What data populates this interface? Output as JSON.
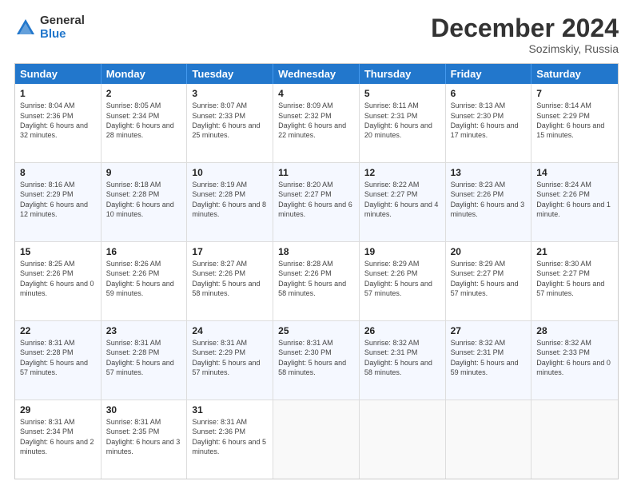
{
  "header": {
    "logo": {
      "general": "General",
      "blue": "Blue"
    },
    "title": "December 2024",
    "subtitle": "Sozimskiy, Russia"
  },
  "calendar": {
    "days_of_week": [
      "Sunday",
      "Monday",
      "Tuesday",
      "Wednesday",
      "Thursday",
      "Friday",
      "Saturday"
    ],
    "rows": [
      [
        {
          "day": "1",
          "sunrise": "8:04 AM",
          "sunset": "2:36 PM",
          "daylight": "6 hours and 32 minutes."
        },
        {
          "day": "2",
          "sunrise": "8:05 AM",
          "sunset": "2:34 PM",
          "daylight": "6 hours and 28 minutes."
        },
        {
          "day": "3",
          "sunrise": "8:07 AM",
          "sunset": "2:33 PM",
          "daylight": "6 hours and 25 minutes."
        },
        {
          "day": "4",
          "sunrise": "8:09 AM",
          "sunset": "2:32 PM",
          "daylight": "6 hours and 22 minutes."
        },
        {
          "day": "5",
          "sunrise": "8:11 AM",
          "sunset": "2:31 PM",
          "daylight": "6 hours and 20 minutes."
        },
        {
          "day": "6",
          "sunrise": "8:13 AM",
          "sunset": "2:30 PM",
          "daylight": "6 hours and 17 minutes."
        },
        {
          "day": "7",
          "sunrise": "8:14 AM",
          "sunset": "2:29 PM",
          "daylight": "6 hours and 15 minutes."
        }
      ],
      [
        {
          "day": "8",
          "sunrise": "8:16 AM",
          "sunset": "2:29 PM",
          "daylight": "6 hours and 12 minutes."
        },
        {
          "day": "9",
          "sunrise": "8:18 AM",
          "sunset": "2:28 PM",
          "daylight": "6 hours and 10 minutes."
        },
        {
          "day": "10",
          "sunrise": "8:19 AM",
          "sunset": "2:28 PM",
          "daylight": "6 hours and 8 minutes."
        },
        {
          "day": "11",
          "sunrise": "8:20 AM",
          "sunset": "2:27 PM",
          "daylight": "6 hours and 6 minutes."
        },
        {
          "day": "12",
          "sunrise": "8:22 AM",
          "sunset": "2:27 PM",
          "daylight": "6 hours and 4 minutes."
        },
        {
          "day": "13",
          "sunrise": "8:23 AM",
          "sunset": "2:26 PM",
          "daylight": "6 hours and 3 minutes."
        },
        {
          "day": "14",
          "sunrise": "8:24 AM",
          "sunset": "2:26 PM",
          "daylight": "6 hours and 1 minute."
        }
      ],
      [
        {
          "day": "15",
          "sunrise": "8:25 AM",
          "sunset": "2:26 PM",
          "daylight": "6 hours and 0 minutes."
        },
        {
          "day": "16",
          "sunrise": "8:26 AM",
          "sunset": "2:26 PM",
          "daylight": "5 hours and 59 minutes."
        },
        {
          "day": "17",
          "sunrise": "8:27 AM",
          "sunset": "2:26 PM",
          "daylight": "5 hours and 58 minutes."
        },
        {
          "day": "18",
          "sunrise": "8:28 AM",
          "sunset": "2:26 PM",
          "daylight": "5 hours and 58 minutes."
        },
        {
          "day": "19",
          "sunrise": "8:29 AM",
          "sunset": "2:26 PM",
          "daylight": "5 hours and 57 minutes."
        },
        {
          "day": "20",
          "sunrise": "8:29 AM",
          "sunset": "2:27 PM",
          "daylight": "5 hours and 57 minutes."
        },
        {
          "day": "21",
          "sunrise": "8:30 AM",
          "sunset": "2:27 PM",
          "daylight": "5 hours and 57 minutes."
        }
      ],
      [
        {
          "day": "22",
          "sunrise": "8:31 AM",
          "sunset": "2:28 PM",
          "daylight": "5 hours and 57 minutes."
        },
        {
          "day": "23",
          "sunrise": "8:31 AM",
          "sunset": "2:28 PM",
          "daylight": "5 hours and 57 minutes."
        },
        {
          "day": "24",
          "sunrise": "8:31 AM",
          "sunset": "2:29 PM",
          "daylight": "5 hours and 57 minutes."
        },
        {
          "day": "25",
          "sunrise": "8:31 AM",
          "sunset": "2:30 PM",
          "daylight": "5 hours and 58 minutes."
        },
        {
          "day": "26",
          "sunrise": "8:32 AM",
          "sunset": "2:31 PM",
          "daylight": "5 hours and 58 minutes."
        },
        {
          "day": "27",
          "sunrise": "8:32 AM",
          "sunset": "2:31 PM",
          "daylight": "5 hours and 59 minutes."
        },
        {
          "day": "28",
          "sunrise": "8:32 AM",
          "sunset": "2:33 PM",
          "daylight": "6 hours and 0 minutes."
        }
      ],
      [
        {
          "day": "29",
          "sunrise": "8:31 AM",
          "sunset": "2:34 PM",
          "daylight": "6 hours and 2 minutes."
        },
        {
          "day": "30",
          "sunrise": "8:31 AM",
          "sunset": "2:35 PM",
          "daylight": "6 hours and 3 minutes."
        },
        {
          "day": "31",
          "sunrise": "8:31 AM",
          "sunset": "2:36 PM",
          "daylight": "6 hours and 5 minutes."
        },
        null,
        null,
        null,
        null
      ]
    ]
  }
}
